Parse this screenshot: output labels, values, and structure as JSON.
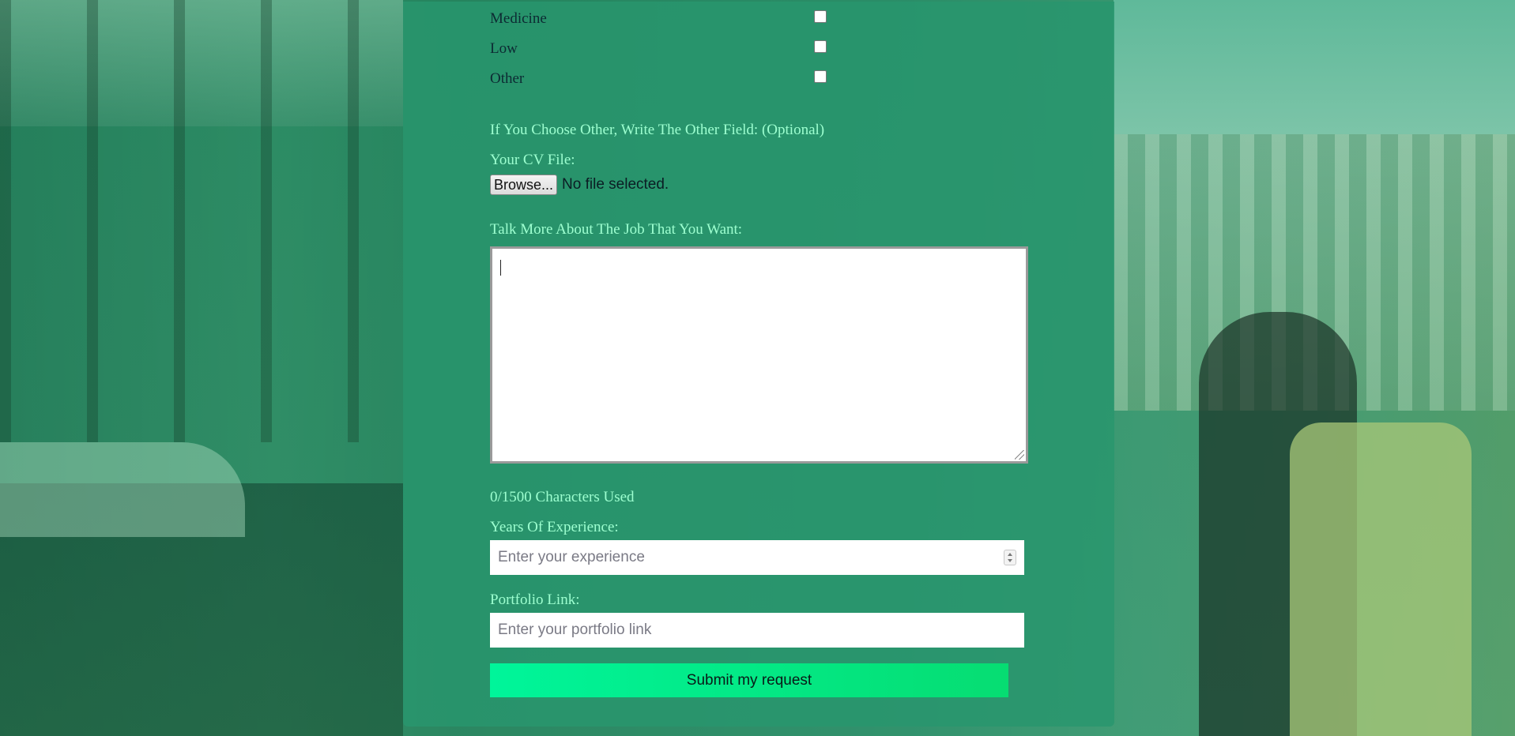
{
  "categories": [
    {
      "label": "Medicine",
      "checked": false
    },
    {
      "label": "Low",
      "checked": false
    },
    {
      "label": "Other",
      "checked": false
    }
  ],
  "other_field": {
    "label": "If You Choose Other, Write The Other Field: (Optional)"
  },
  "cv": {
    "label": "Your CV File:",
    "button_label": "Browse...",
    "status": "No file selected."
  },
  "job": {
    "label": "Talk More About The Job That You Want:",
    "value": ""
  },
  "char_counter": "0/1500 Characters Used",
  "experience": {
    "label": "Years Of Experience:",
    "placeholder": "Enter your experience"
  },
  "portfolio": {
    "label": "Portfolio Link:",
    "placeholder": "Enter your portfolio link"
  },
  "submit_label": "Submit my request"
}
